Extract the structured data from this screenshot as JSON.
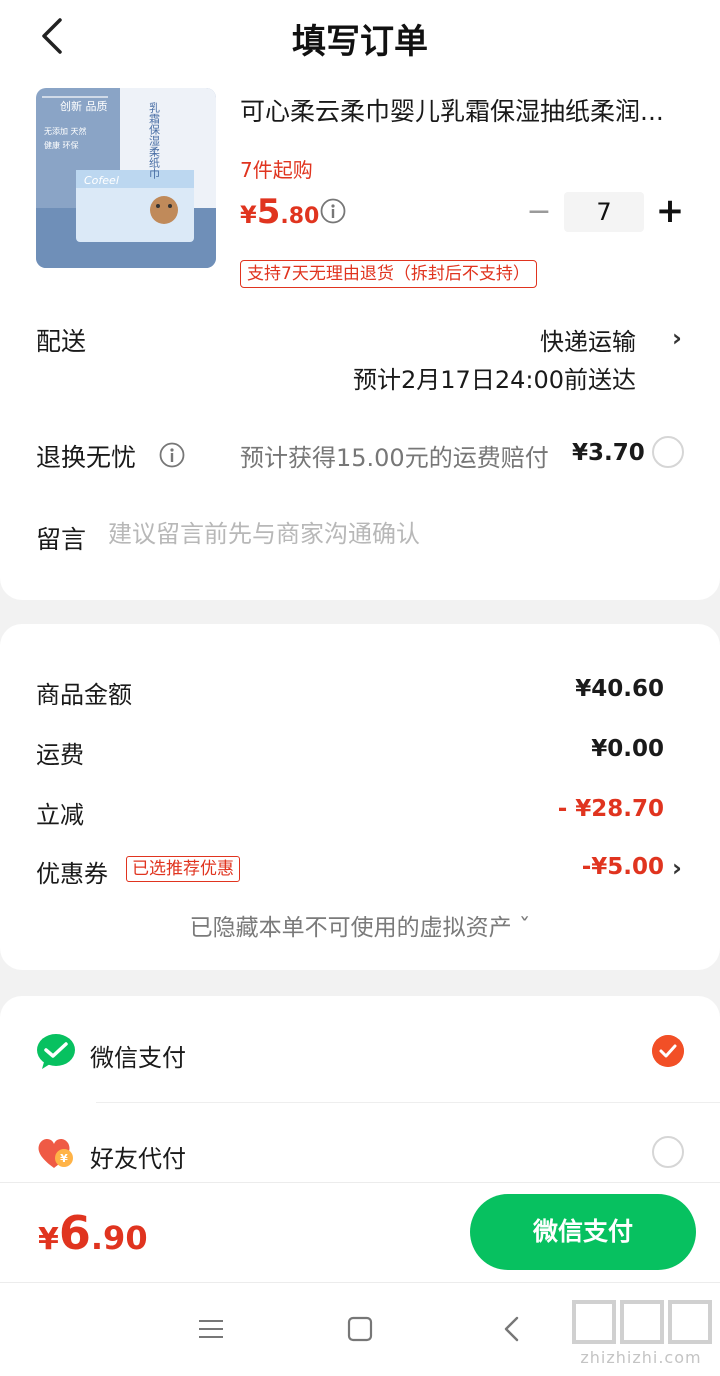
{
  "header": {
    "title": "填写订单"
  },
  "product": {
    "title": "可心柔云柔巾婴儿乳霜保湿抽纸柔润...",
    "min_qty_note": "7件起购",
    "price_currency": "¥",
    "price_int": "5",
    "price_dec": ".80",
    "quantity": "7",
    "return_policy": "支持7天无理由退货（拆封后不支持）",
    "thumb_text": {
      "tag1": "创新 品质",
      "tag2": "无添加 天然",
      "tag3": "健康 环保",
      "vertical": "乳霜保湿柔纸巾",
      "brand": "Cofeel"
    }
  },
  "delivery": {
    "label": "配送",
    "method": "快递运输",
    "eta": "预计2月17日24:00前送达"
  },
  "return_insurance": {
    "label": "退换无忧",
    "text": "预计获得15.00元的运费赔付",
    "price": "¥3.70"
  },
  "message": {
    "label": "留言",
    "placeholder": "建议留言前先与商家沟通确认"
  },
  "fees": {
    "goods_label": "商品金额",
    "goods_value": "¥40.60",
    "shipping_label": "运费",
    "shipping_value": "¥0.00",
    "discount_label": "立减",
    "discount_value": "- ¥28.70",
    "coupon_label": "优惠券",
    "coupon_tag": "已选推荐优惠",
    "coupon_value": "-¥5.00"
  },
  "hidden_assets": "已隐藏本单不可使用的虚拟资产 ˇ",
  "payment": {
    "wechat_label": "微信支付",
    "friend_label": "好友代付"
  },
  "bottom": {
    "total_currency": "¥",
    "total_int": "6",
    "total_dec": ".90",
    "pay_button": "微信支付"
  },
  "watermark": {
    "text": "zhizhizhi.com",
    "logo": "值值值"
  },
  "colors": {
    "accent_red": "#e0341f",
    "wechat_green": "#07c160",
    "check_orange": "#f24f26"
  }
}
